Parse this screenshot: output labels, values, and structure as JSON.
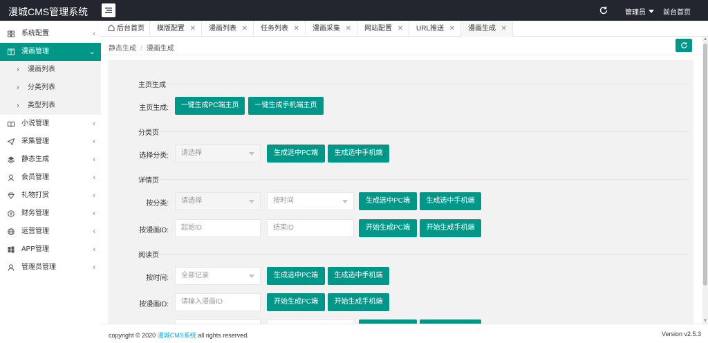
{
  "header": {
    "brand": "漫城CMS管理系统",
    "user_label": "管理员",
    "home_link": "前台首页"
  },
  "sidebar": {
    "items": [
      {
        "label": "系统配置",
        "icon": "sliders-icon"
      },
      {
        "label": "漫画管理",
        "icon": "book-icon",
        "active": true,
        "children": [
          {
            "label": "漫画列表"
          },
          {
            "label": "分类列表"
          },
          {
            "label": "类型列表"
          }
        ]
      },
      {
        "label": "小说管理",
        "icon": "open-book-icon"
      },
      {
        "label": "采集管理",
        "icon": "send-icon"
      },
      {
        "label": "静态生成",
        "icon": "layers-icon"
      },
      {
        "label": "会员管理",
        "icon": "user-icon"
      },
      {
        "label": "礼物打赏",
        "icon": "diamond-icon"
      },
      {
        "label": "财务管理",
        "icon": "yen-icon"
      },
      {
        "label": "运营管理",
        "icon": "globe-icon"
      },
      {
        "label": "APP管理",
        "icon": "windows-icon"
      },
      {
        "label": "管理员管理",
        "icon": "person-icon"
      }
    ]
  },
  "tabs": [
    {
      "label": "后台首页",
      "closable": false
    },
    {
      "label": "模版配置",
      "closable": true
    },
    {
      "label": "漫画列表",
      "closable": true
    },
    {
      "label": "任务列表",
      "closable": true
    },
    {
      "label": "漫画采集",
      "closable": true
    },
    {
      "label": "网站配置",
      "closable": true
    },
    {
      "label": "URL推送",
      "closable": true
    },
    {
      "label": "漫画生成",
      "closable": true,
      "active": true
    }
  ],
  "breadcrumb": {
    "parent": "静态生成",
    "separator": "/",
    "current": "漫画生成"
  },
  "form": {
    "home": {
      "title": "主页生成",
      "label": "主页生成:",
      "btn_pc": "一键生成PC端主页",
      "btn_mobile": "一键生成手机端主页"
    },
    "category": {
      "title": "分类页",
      "label": "选择分类:",
      "select_placeholder": "请选择",
      "btn_pc": "生成选中PC端",
      "btn_mobile": "生成选中手机端"
    },
    "detail": {
      "title": "详情页",
      "label_by_category": "按分类:",
      "select_placeholder": "请选择",
      "time_select": "按时间",
      "btn_pc": "生成选中PC端",
      "btn_mobile": "生成选中手机端",
      "label_by_id": "按漫画ID:",
      "start_placeholder": "起始ID",
      "end_placeholder": "结束ID",
      "btn_start_pc": "开始生成PC端",
      "btn_start_mobile": "开始生成手机端"
    },
    "read": {
      "title": "阅读页",
      "label_by_time": "按时间:",
      "time_select": "全部记录",
      "btn_pc": "生成选中PC端",
      "btn_mobile": "生成选中手机端",
      "label_by_id": "按漫画ID:",
      "id_placeholder": "请输入漫画ID",
      "btn_start_pc": "开始生成PC端",
      "btn_start_mobile": "开始生成手机端"
    }
  },
  "footer": {
    "copy_prefix": "copyright © 2020",
    "copy_link": "漫城CMS系统",
    "copy_suffix": "all rights reserved.",
    "version": "Version v2.5.3"
  },
  "colors": {
    "accent": "#009688",
    "topbar": "#23262e",
    "link": "#01AAED"
  }
}
